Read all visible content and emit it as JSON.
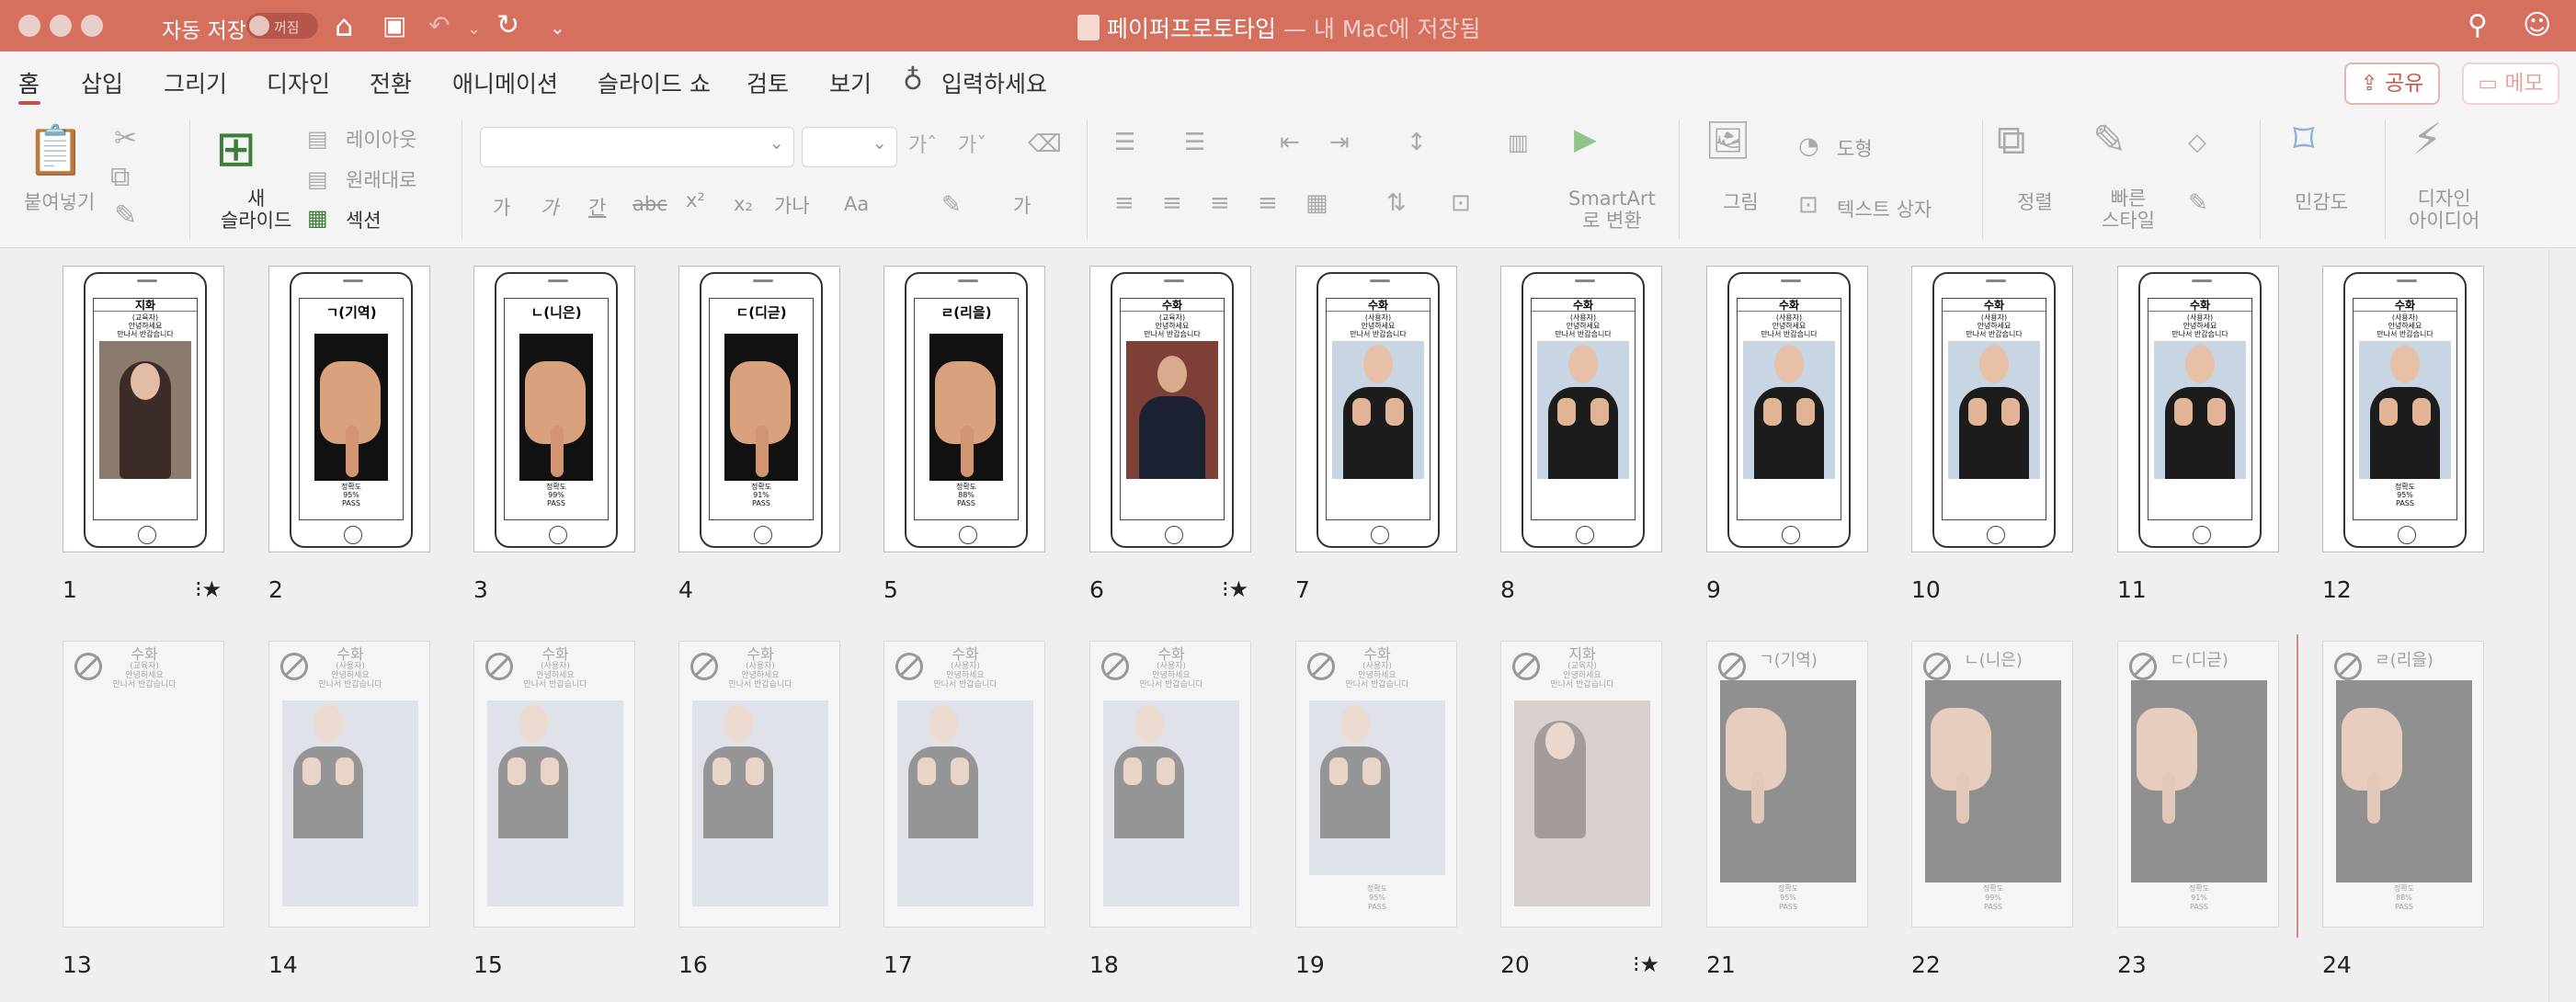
{
  "titlebar": {
    "autosave_label": "자동 저장",
    "autosave_state": "꺼짐",
    "doc_title": "페이퍼프로토타입",
    "doc_subtitle": "— 내 Mac에 저장됨",
    "icons": [
      "home-icon",
      "save-icon",
      "undo-icon",
      "redo-icon",
      "customize-icon",
      "search-icon",
      "account-icon"
    ]
  },
  "tabs": [
    "홈",
    "삽입",
    "그리기",
    "디자인",
    "전환",
    "애니메이션",
    "슬라이드 쇼",
    "검토",
    "보기"
  ],
  "tell_me": "입력하세요",
  "share_label": "공유",
  "memo_label": "메모",
  "ribbon": {
    "paste": "붙여넣기",
    "new_slide_line1": "새",
    "new_slide_line2": "슬라이드",
    "layout": "레이아웃",
    "reset": "원래대로",
    "section": "섹션",
    "smartart_line1": "SmartArt",
    "smartart_line2": "로 변환",
    "picture": "그림",
    "shape": "도형",
    "textbox": "텍스트 상자",
    "arrange": "정렬",
    "quick_styles_line1": "빠른",
    "quick_styles_line2": "스타일",
    "sensitivity": "민감도",
    "designer_line1": "디자인",
    "designer_line2": "아이디어",
    "font_buttons": [
      "가",
      "가",
      "간",
      "가",
      "x²",
      "x₂",
      "가나",
      "Aa",
      "가"
    ]
  },
  "slides_row1": [
    {
      "num": "1",
      "title": "지화",
      "greet": "(교육자)\n안녕하세요\n만나서 반갑습니다",
      "kind": "room",
      "anim": true
    },
    {
      "num": "2",
      "big": "ㄱ(기역)",
      "kind": "hand",
      "acc": "정확도\n95%\nPASS"
    },
    {
      "num": "3",
      "big": "ㄴ(니은)",
      "kind": "hand",
      "acc": "정확도\n99%\nPASS"
    },
    {
      "num": "4",
      "big": "ㄷ(디귿)",
      "kind": "hand",
      "acc": "정확도\n91%\nPASS"
    },
    {
      "num": "5",
      "big": "ㄹ(리을)",
      "kind": "hand",
      "acc": "정확도\n88%\nPASS"
    },
    {
      "num": "6",
      "title": "수화",
      "greet": "(교육자)\n안녕하세요\n만나서 반갑습니다",
      "kind": "portrait",
      "anim": true
    },
    {
      "num": "7",
      "title": "수화",
      "greet": "(사용자)\n안녕하세요\n만나서 반갑습니다",
      "kind": "signer"
    },
    {
      "num": "8",
      "title": "수화",
      "greet": "(사용자)\n안녕하세요\n만나서 반갑습니다",
      "kind": "signer"
    },
    {
      "num": "9",
      "title": "수화",
      "greet": "(사용자)\n안녕하세요\n만나서 반갑습니다",
      "kind": "signer"
    },
    {
      "num": "10",
      "title": "수화",
      "greet": "(사용자)\n안녕하세요\n만나서 반갑습니다",
      "kind": "signer"
    },
    {
      "num": "11",
      "title": "수화",
      "greet": "(사용자)\n안녕하세요\n만나서 반갑습니다",
      "kind": "signer"
    },
    {
      "num": "12",
      "title": "수화",
      "greet": "(사용자)\n안녕하세요\n만나서 반갑습니다",
      "kind": "signer",
      "acc": "정확도\n95%\nPASS"
    }
  ],
  "slides_row2": [
    {
      "num": "13",
      "title": "수화",
      "greet": "(교육자)\n안녕하세요\n만나서 반갑습니다",
      "kind": "none"
    },
    {
      "num": "14",
      "title": "수화",
      "greet": "(사용자)\n안녕하세요\n만나서 반갑습니다",
      "kind": "signer"
    },
    {
      "num": "15",
      "title": "수화",
      "greet": "(사용자)\n안녕하세요\n만나서 반갑습니다",
      "kind": "signer"
    },
    {
      "num": "16",
      "title": "수화",
      "greet": "(사용자)\n안녕하세요\n만나서 반갑습니다",
      "kind": "signer"
    },
    {
      "num": "17",
      "title": "수화",
      "greet": "(사용자)\n안녕하세요\n만나서 반갑습니다",
      "kind": "signer"
    },
    {
      "num": "18",
      "title": "수화",
      "greet": "(사용자)\n안녕하세요\n만나서 반갑습니다",
      "kind": "signer"
    },
    {
      "num": "19",
      "title": "수화",
      "greet": "(사용자)\n안녕하세요\n만나서 반갑습니다",
      "kind": "signer",
      "acc": "정확도\n95%\nPASS"
    },
    {
      "num": "20",
      "title": "지화",
      "greet": "(교육자)\n안녕하세요\n만나서 반갑습니다",
      "kind": "room",
      "anim": true
    },
    {
      "num": "21",
      "big": "ㄱ(기역)",
      "kind": "hand",
      "acc": "정확도\n95%\nPASS"
    },
    {
      "num": "22",
      "big": "ㄴ(니은)",
      "kind": "hand",
      "acc": "정확도\n99%\nPASS"
    },
    {
      "num": "23",
      "big": "ㄷ(디귿)",
      "kind": "hand",
      "acc": "정확도\n91%\nPASS"
    },
    {
      "num": "24",
      "big": "ㄹ(리을)",
      "kind": "hand",
      "acc": "정확도\n88%\nPASS"
    }
  ],
  "colors": {
    "titlebar": "#d5705f",
    "accent": "#c0504d",
    "pass": "#3a6dd8"
  }
}
